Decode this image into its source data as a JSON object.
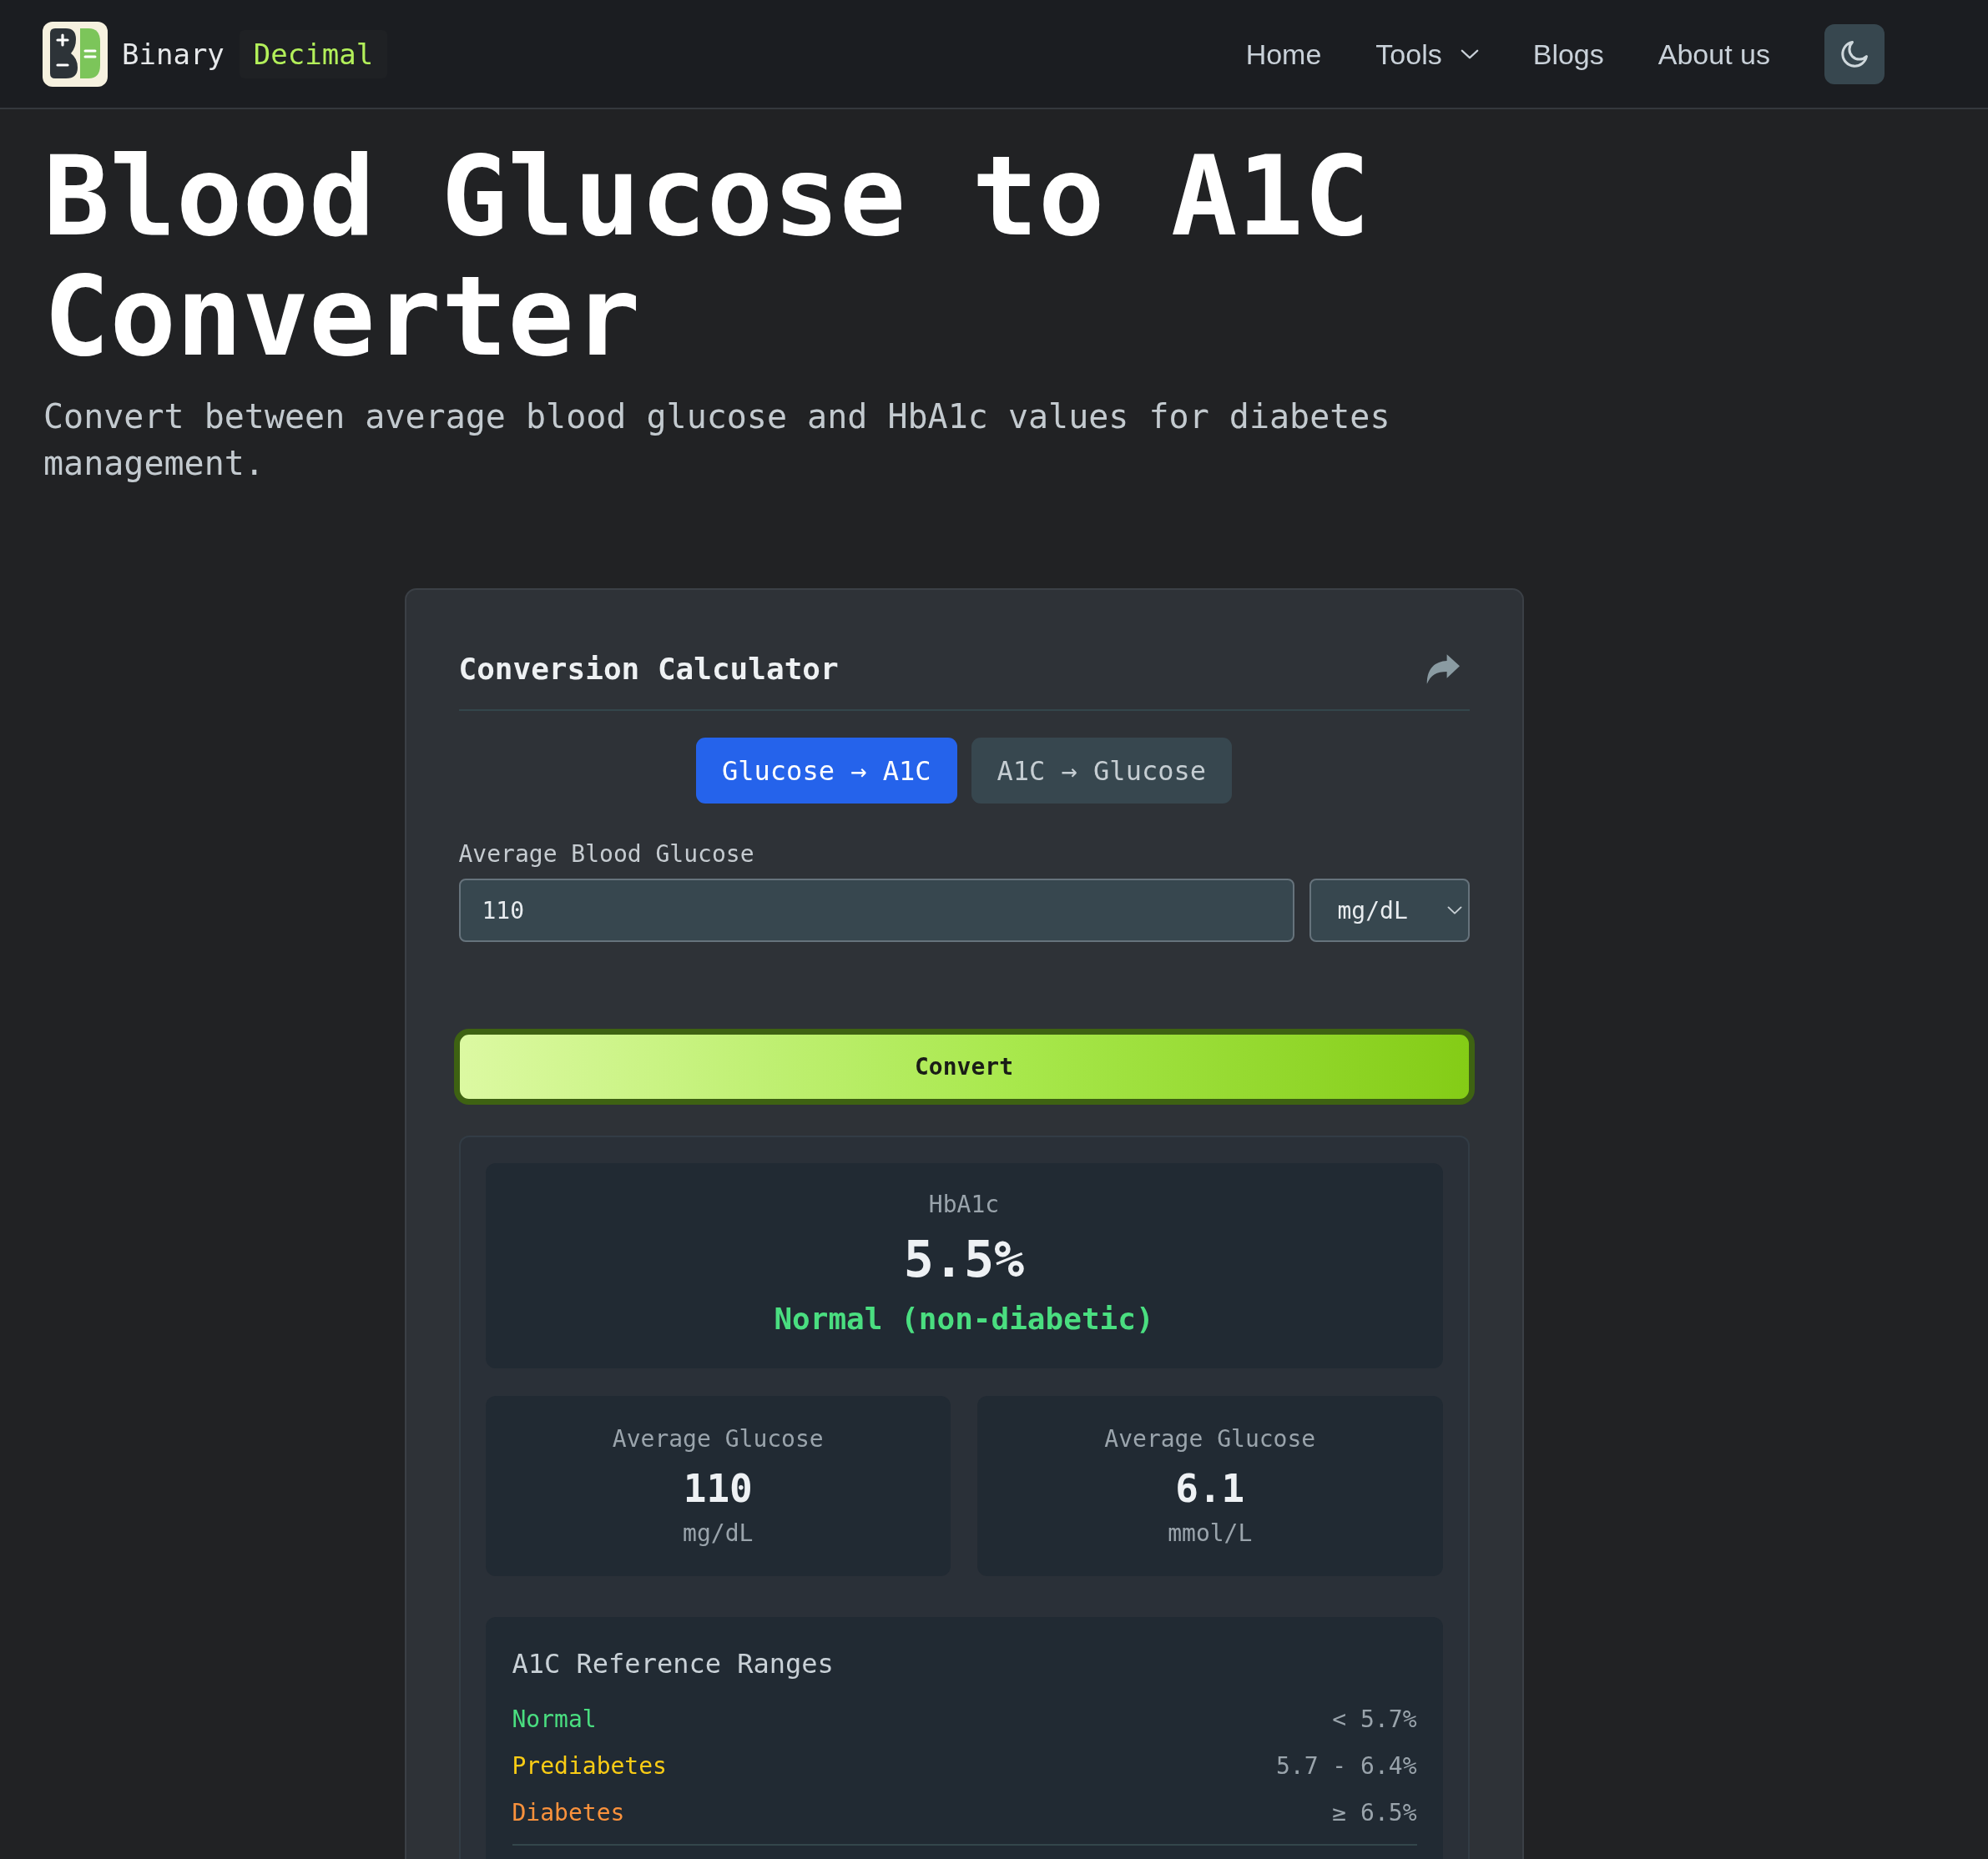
{
  "header": {
    "brand": {
      "name": "Binary",
      "suffix": "Decimal"
    },
    "nav": [
      {
        "label": "Home",
        "kind": "link"
      },
      {
        "label": "Tools",
        "kind": "dropdown"
      },
      {
        "label": "Blogs",
        "kind": "link"
      },
      {
        "label": "About us",
        "kind": "link"
      }
    ]
  },
  "hero": {
    "title": "Blood Glucose to A1C Converter",
    "subtitle": "Convert between average blood glucose and HbA1c values for diabetes management."
  },
  "calculator": {
    "title": "Conversion Calculator",
    "modes": [
      {
        "label": "Glucose → A1C",
        "selected": true
      },
      {
        "label": "A1C → Glucose",
        "selected": false
      }
    ],
    "input": {
      "label": "Average Blood Glucose",
      "value": "110"
    },
    "unit_select": {
      "value": "mg/dL"
    },
    "convert_button": "Convert",
    "result": {
      "label": "HbA1c",
      "value": "5.5%",
      "status": "Normal (non-diabetic)"
    },
    "details": [
      {
        "label": "Average Glucose",
        "value": "110",
        "unit": "mg/dL"
      },
      {
        "label": "Average Glucose",
        "value": "6.1",
        "unit": "mmol/L"
      }
    ],
    "reference": {
      "title": "A1C Reference Ranges",
      "rows": [
        {
          "name": "Normal",
          "range": "< 5.7%",
          "color": "#4ade80"
        },
        {
          "name": "Prediabetes",
          "range": "5.7 - 6.4%",
          "color": "#facc15"
        },
        {
          "name": "Diabetes",
          "range": "≥ 6.5%",
          "color": "#fb923c"
        }
      ]
    }
  }
}
